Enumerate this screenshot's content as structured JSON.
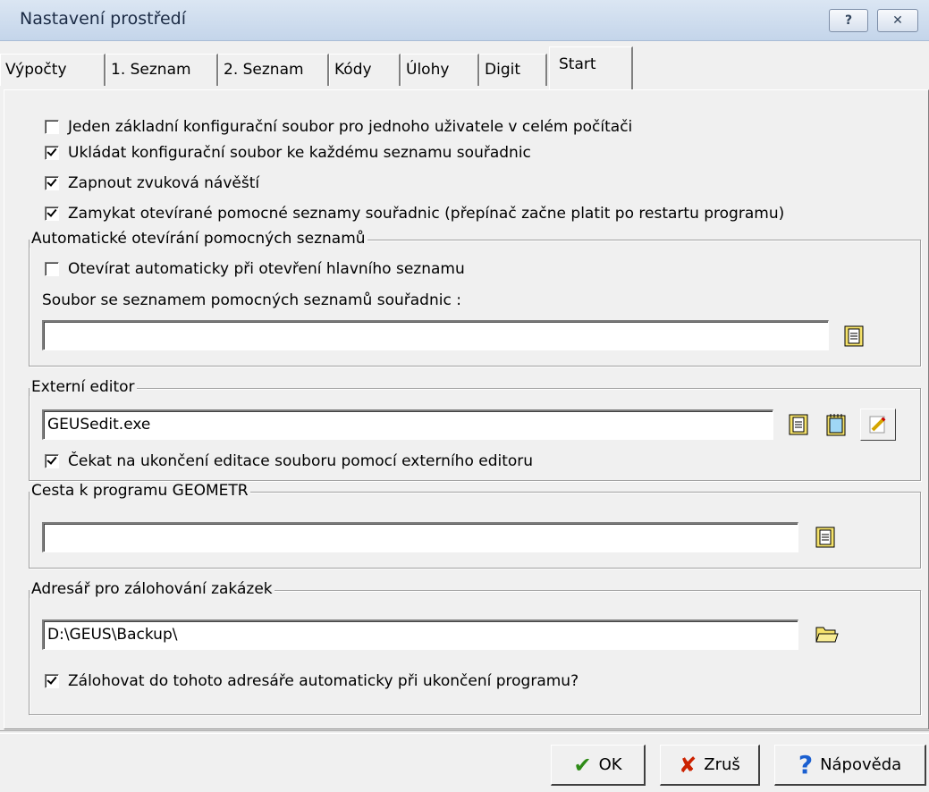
{
  "window": {
    "title": "Nastavení prostředí",
    "help_button": "?",
    "close_button": "✕"
  },
  "tabs": [
    {
      "label": "Výpočty"
    },
    {
      "label": "1. Seznam"
    },
    {
      "label": "2. Seznam"
    },
    {
      "label": "Kódy"
    },
    {
      "label": "Úlohy"
    },
    {
      "label": "Digit"
    },
    {
      "label": "Start"
    }
  ],
  "start": {
    "options": [
      {
        "label": "Jeden základní konfigurační soubor pro jednoho uživatele v celém počítači",
        "checked": false
      },
      {
        "label": "Ukládat konfigurační soubor ke každému seznamu souřadnic",
        "checked": true
      },
      {
        "label": "Zapnout zvuková návěští",
        "checked": true
      },
      {
        "label": "Zamykat otevírané pomocné seznamy souřadnic (přepínač začne platit po restartu programu)",
        "checked": true
      }
    ],
    "auto_open": {
      "title": "Automatické otevírání pomocných seznamů",
      "checkbox_label": "Otevírat automaticky při otevření hlavního seznamu",
      "checkbox_checked": false,
      "file_label": "Soubor se seznamem pomocných seznamů souřadnic :",
      "file_value": ""
    },
    "editor": {
      "title": "Externí editor",
      "value": "GEUSedit.exe",
      "wait_label": "Čekat na ukončení editace souboru pomocí externího editoru",
      "wait_checked": true
    },
    "geometr": {
      "title": "Cesta k programu GEOMETR",
      "value": ""
    },
    "backup": {
      "title": "Adresář pro zálohování zakázek",
      "value": "D:\\GEUS\\Backup\\",
      "auto_label": "Zálohovat do tohoto adresáře automaticky při ukončení programu?",
      "auto_checked": true
    }
  },
  "buttons": {
    "ok": "OK",
    "cancel": "Zruš",
    "help": "Nápověda"
  },
  "colors": {
    "ok_check": "#2e8b17",
    "cancel_x": "#cc2200",
    "help_q": "#1a5fd0",
    "icon_yellow": "#f5e26a"
  }
}
